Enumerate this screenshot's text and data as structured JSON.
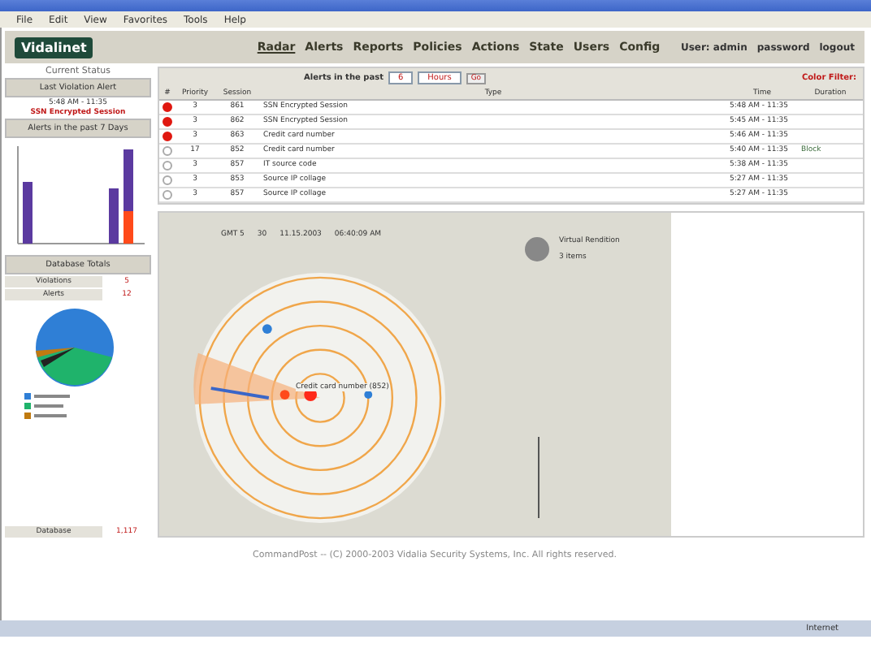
{
  "menu": [
    "File",
    "Edit",
    "View",
    "Favorites",
    "Tools",
    "Help"
  ],
  "app": {
    "logo": "Vidalinet",
    "nav": [
      {
        "label": "Radar",
        "selected": true
      },
      {
        "label": "Alerts",
        "selected": false
      },
      {
        "label": "Reports",
        "selected": false
      },
      {
        "label": "Policies",
        "selected": false
      },
      {
        "label": "Actions",
        "selected": false
      },
      {
        "label": "State",
        "selected": false
      },
      {
        "label": "Users",
        "selected": false
      },
      {
        "label": "Config",
        "selected": false
      }
    ],
    "user": "User: admin",
    "links": [
      "password",
      "logout"
    ]
  },
  "sidebar": {
    "title": "Current Status",
    "last_alert": {
      "heading": "Last Violation Alert",
      "time": "5:48 AM - 11:35",
      "type": "SSN Encrypted Session"
    },
    "chart_heading": "Alerts in the past 7 Days",
    "totals_heading": "Database Totals",
    "totals": [
      {
        "label": "Violations",
        "value": "5"
      },
      {
        "label": "Alerts",
        "value": "12"
      }
    ],
    "footer": {
      "label": "Database",
      "value": "1,117"
    }
  },
  "alerts": {
    "heading": "Alerts in the past",
    "count": "6",
    "unit": "Hours",
    "go": "Go",
    "filter": "Color Filter:",
    "columns": [
      "#",
      "Priority",
      "Session",
      "Type",
      "Time",
      "Duration"
    ],
    "rows": [
      {
        "flagged": true,
        "priority": "3",
        "session": "861",
        "type": "SSN Encrypted Session",
        "time": "5:48 AM - 11:35",
        "note": ""
      },
      {
        "flagged": true,
        "priority": "3",
        "session": "862",
        "type": "SSN Encrypted Session",
        "time": "5:45 AM - 11:35",
        "note": ""
      },
      {
        "flagged": true,
        "priority": "3",
        "session": "863",
        "type": "Credit card number",
        "time": "5:46 AM - 11:35",
        "note": ""
      },
      {
        "flagged": false,
        "priority": "17",
        "session": "852",
        "type": "Credit card number",
        "time": "5:40 AM - 11:35",
        "note": "Block"
      },
      {
        "flagged": false,
        "priority": "3",
        "session": "857",
        "type": "IT source code",
        "time": "5:38 AM - 11:35",
        "note": ""
      },
      {
        "flagged": false,
        "priority": "3",
        "session": "853",
        "type": "Source IP collage",
        "time": "5:27 AM - 11:35",
        "note": ""
      },
      {
        "flagged": false,
        "priority": "3",
        "session": "857",
        "type": "Source IP collage",
        "time": "5:27 AM - 11:35",
        "note": ""
      }
    ]
  },
  "radar": {
    "stamp": [
      "GMT 5",
      "30",
      "11.15.2003",
      "06:40:09 AM"
    ],
    "legend": "Virtual Rendition",
    "legend_count": "3 items",
    "label": "Credit card number (852)"
  },
  "footer": "CommandPost -- (C) 2000-2003 Vidalia Security Systems, Inc. All rights reserved.",
  "status": "Internet"
}
